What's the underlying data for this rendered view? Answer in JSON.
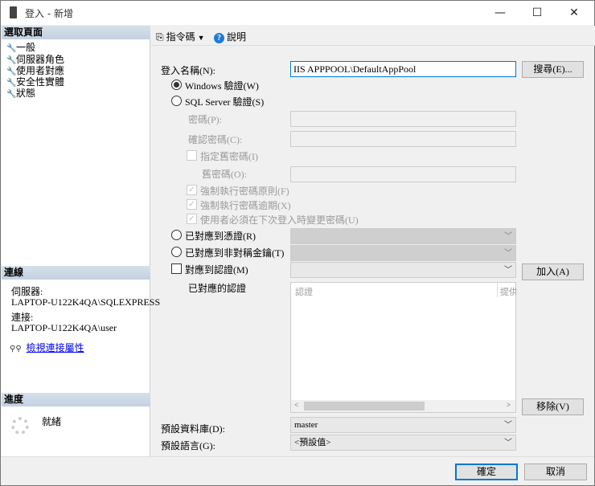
{
  "window": {
    "title": "登入 - 新增",
    "minimize": "—",
    "maximize": "☐",
    "close": "✕"
  },
  "sidebar": {
    "pages_header": "選取頁面",
    "pages": [
      "一般",
      "伺服器角色",
      "使用者對應",
      "安全性實體",
      "狀態"
    ],
    "connection_header": "連線",
    "server_label": "伺服器:",
    "server_value": "LAPTOP-U122K4QA\\SQLEXPRESS",
    "connection_label": "連接:",
    "connection_value": "LAPTOP-U122K4QA\\user",
    "view_props_link": "檢視連接屬性",
    "progress_header": "進度",
    "progress_status": "就緒"
  },
  "toolbar": {
    "script_label": "指令碼",
    "help_label": "說明"
  },
  "form": {
    "login_name_label": "登入名稱(N):",
    "login_name_value": "IIS APPPOOL\\DefaultAppPool",
    "search_button": "搜尋(E)...",
    "windows_auth": "Windows 驗證(W)",
    "sql_auth": "SQL Server 驗證(S)",
    "password_label": "密碼(P):",
    "confirm_password_label": "確認密碼(C):",
    "specify_old_password": "指定舊密碼(I)",
    "old_password_label": "舊密碼(O):",
    "enforce_policy": "強制執行密碼原則(F)",
    "enforce_expiration": "強制執行密碼逾期(X)",
    "must_change": "使用者必須在下次登入時變更密碼(U)",
    "mapped_credential": "已對應到憑證(R)",
    "mapped_asym_key": "已對應到非對稱金鑰(T)",
    "map_to_credential": "對應到認證(M)",
    "add_button": "加入(A)",
    "mapped_credentials_label": "已對應的認證",
    "grid_columns": [
      "認證",
      "提供"
    ],
    "remove_button": "移除(V)",
    "default_db_label": "預設資料庫(D):",
    "default_db_value": "master",
    "default_lang_label": "預設語言(G):",
    "default_lang_value": "<預設值>"
  },
  "footer": {
    "ok": "確定",
    "cancel": "取消"
  }
}
